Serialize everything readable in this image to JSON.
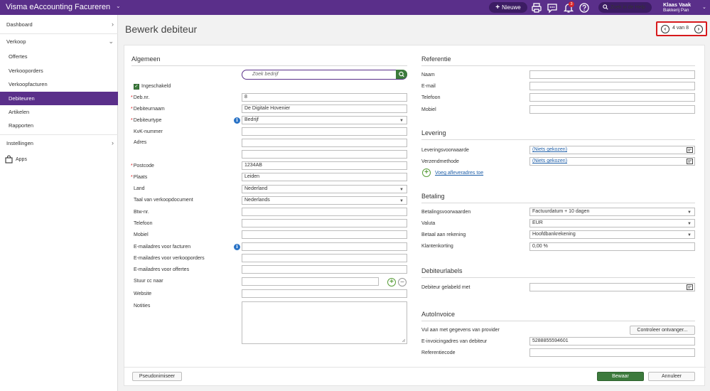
{
  "topbar": {
    "app_title": "Visma eAccounting Facureren",
    "new_button": "Nieuwe",
    "notification_count": "3",
    "help_button": "Zoek in de Help",
    "user_name": "Klaas Vaak",
    "user_company": "Bakkerij Pan"
  },
  "sidebar": {
    "dashboard": "Dashboard",
    "verkoop": "Verkoop",
    "offertes": "Offertes",
    "verkooporders": "Verkooporders",
    "verkoopfacturen": "Verkoopfacturen",
    "debiteuren": "Debiteuren",
    "artikelen": "Artikelen",
    "rapporten": "Rapporten",
    "instellingen": "Instellingen",
    "apps": "Apps"
  },
  "header": {
    "title": "Bewerk debiteur",
    "pager": "4 van 8"
  },
  "algemeen": {
    "title": "Algemeen",
    "search_placeholder": "Zoek bedrijf",
    "enabled_label": "Ingeschakeld",
    "deb_nr_label": "Deb.nr.",
    "deb_nr_value": "8",
    "naam_label": "Debiteurnaam",
    "naam_value": "De Digitale Hovenier",
    "type_label": "Debiteurtype",
    "type_value": "Bedrijf",
    "kvk_label": "KvK-nummer",
    "adres_label": "Adres",
    "postcode_label": "Postcode",
    "postcode_value": "1234AB",
    "plaats_label": "Plaats",
    "plaats_value": "Leiden",
    "land_label": "Land",
    "land_value": "Nederland",
    "taal_label": "Taal van verkoopdocument",
    "taal_value": "Nederlands",
    "btw_label": "Btw-nr.",
    "telefoon_label": "Telefoon",
    "mobiel_label": "Mobiel",
    "email_facturen_label": "E-mailadres voor facturen",
    "email_orders_label": "E-mailadres voor verkooporders",
    "email_offertes_label": "E-mailadres voor offertes",
    "cc_label": "Stuur cc naar",
    "website_label": "Website",
    "notities_label": "Notities"
  },
  "referentie": {
    "title": "Referentie",
    "naam_label": "Naam",
    "email_label": "E-mail",
    "telefoon_label": "Telefoon",
    "mobiel_label": "Mobiel"
  },
  "levering": {
    "title": "Levering",
    "voorwaarde_label": "Leveringsvoorwaarde",
    "voorwaarde_value": "(Niets gekozen)",
    "methode_label": "Verzendmethode",
    "methode_value": "(Niets gekozen)",
    "add_address": "Voeg afleveradres toe"
  },
  "betaling": {
    "title": "Betaling",
    "voorwaarden_label": "Betalingsvoorwaarden",
    "voorwaarden_value": "Factuurdatum + 10 dagen",
    "valuta_label": "Valuta",
    "valuta_value": "EUR",
    "rekening_label": "Betaal aan rekening",
    "rekening_value": "Hoofdbankrekening",
    "korting_label": "Klantenkorting",
    "korting_value": "0,00 %"
  },
  "debiteurlabels": {
    "title": "Debiteurlabels",
    "label": "Debiteur gelabeld met"
  },
  "autoinvoice": {
    "title": "AutoInvoice",
    "provider_label": "Vul aan met gegevens van provider",
    "check_button": "Controleer ontvanger...",
    "address_label": "E-invoicingadres van debiteur",
    "address_value": "5288855594601",
    "ref_label": "Referentiecode"
  },
  "footer": {
    "pseudonymize": "Pseudonimiseer",
    "save": "Bewaar",
    "cancel": "Annuleer"
  }
}
